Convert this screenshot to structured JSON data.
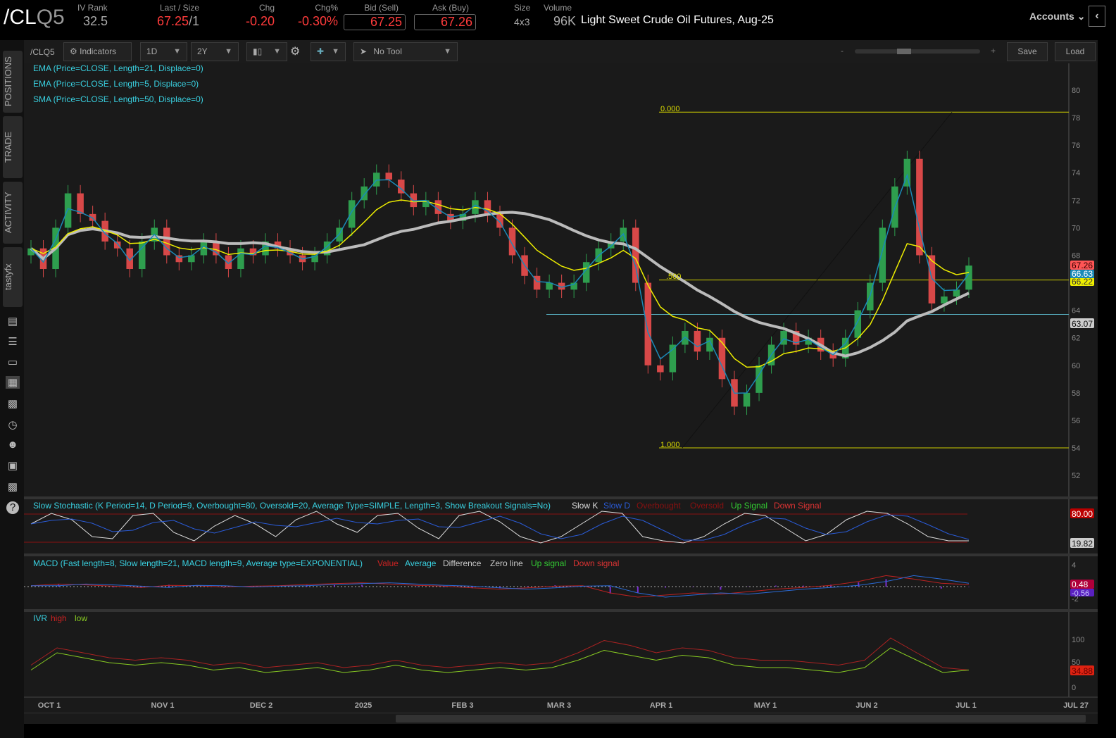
{
  "header": {
    "symbol_main": "/CL",
    "symbol_sub": "Q5",
    "iv_rank_label": "IV Rank",
    "iv_rank": "32.5",
    "last_label": "Last / Size",
    "last": "67.25",
    "size": "/1",
    "chg_label": "Chg",
    "chg": "-0.20",
    "chgp_label": "Chg%",
    "chgp": "-0.30%",
    "bid_label": "Bid (Sell)",
    "bid": "67.25",
    "ask_label": "Ask (Buy)",
    "ask": "67.26",
    "sz_label": "Size",
    "sz": "4x3",
    "vol_label": "Volume",
    "vol": "96K",
    "title": "Light Sweet Crude Oil Futures, Aug-25",
    "accounts": "Accounts"
  },
  "sidebar": {
    "tabs": [
      "POSITIONS",
      "TRADE",
      "ACTIVITY",
      "tastyfx"
    ]
  },
  "toolbar": {
    "symbol": "/CLQ5",
    "indicators": "Indicators",
    "interval": "1D",
    "range": "2Y",
    "tool": "No Tool",
    "zoom_minus": "-",
    "zoom_plus": "+",
    "save": "Save",
    "load": "Load"
  },
  "studies": [
    "EMA (Price=CLOSE, Length=21, Displace=0)",
    "EMA (Price=CLOSE, Length=5, Displace=0)",
    "SMA (Price=CLOSE, Length=50, Displace=0)"
  ],
  "fib": {
    "top": "0.000",
    "mid": ".500",
    "bottom": "1.000",
    "top_price": 78.4,
    "bottom_price": 54.0
  },
  "support_level": 63.7,
  "price_axis": [
    "80",
    "78",
    "76",
    "74",
    "72",
    "70",
    "68",
    "66",
    "64",
    "62",
    "60",
    "58",
    "56",
    "54",
    "52"
  ],
  "price_badges": {
    "last": "67.26",
    "ema5": "66.63",
    "ema21": "66.22",
    "sma50": "63.07"
  },
  "stoch": {
    "title": "Slow Stochastic (K Period=14, D Period=9, Overbought=80, Oversold=20, Average Type=SIMPLE, Length=3, Show Breakout Signals=No)",
    "legend": [
      "Slow K",
      "Slow D",
      "Overbought",
      "Oversold",
      "Up Signal",
      "Down Signal"
    ],
    "badge_ob": "80.00",
    "badge_k": "19.82"
  },
  "macd": {
    "title": "MACD (Fast length=8, Slow length=21, MACD length=9, Average type=EXPONENTIAL)",
    "legend": [
      "Value",
      "Average",
      "Difference",
      "Zero line",
      "Up signal",
      "Down signal"
    ],
    "axis": [
      "4",
      "-2"
    ],
    "badge_value": "0.48",
    "badge_avg": "-0.56"
  },
  "ivr": {
    "title": "IVR",
    "legend": [
      "high",
      "low"
    ],
    "axis": [
      "100",
      "50",
      "0"
    ],
    "badge": "34.88"
  },
  "x_axis": [
    "OCT 1",
    "NOV 1",
    "DEC 2",
    "2025",
    "FEB 3",
    "MAR 3",
    "APR 1",
    "MAY 1",
    "JUN 2",
    "JUL 1",
    "JUL 27"
  ],
  "chart_data": {
    "type": "candlestick",
    "series_name": "/CLQ5 daily close (approx)",
    "closes": [
      68.5,
      67,
      70,
      72.5,
      71,
      70.5,
      69,
      68.5,
      67,
      69,
      70,
      68,
      67.5,
      68,
      69,
      68,
      67,
      68.5,
      68,
      69,
      68.5,
      68,
      67.5,
      68,
      69,
      70,
      72,
      73,
      74,
      73.5,
      72.5,
      71.5,
      72,
      71,
      70.5,
      71,
      72,
      71,
      70,
      68,
      66.5,
      65.5,
      66,
      65.5,
      66,
      67.5,
      68.5,
      69,
      70,
      66,
      60,
      59.5,
      61.5,
      62.5,
      61,
      62,
      59,
      57,
      58,
      60,
      61.5,
      62.5,
      61.5,
      62,
      61,
      60.5,
      62,
      64,
      66,
      70,
      73,
      75,
      68,
      64.5,
      65,
      65.5,
      67.25
    ],
    "stoch_k": [
      60,
      85,
      70,
      30,
      25,
      80,
      85,
      40,
      20,
      55,
      80,
      60,
      30,
      70,
      90,
      60,
      40,
      80,
      85,
      50,
      25,
      80,
      90,
      65,
      30,
      15,
      30,
      60,
      90,
      85,
      30,
      20,
      15,
      30,
      60,
      85,
      80,
      50,
      20,
      35,
      70,
      90,
      85,
      60,
      30,
      20,
      20
    ],
    "macd_value": [
      0.2,
      0.6,
      0.4,
      0.1,
      -0.2,
      0.3,
      0.2,
      -0.1,
      0.1,
      0.2,
      0.5,
      0.7,
      0.9,
      0.6,
      0.3,
      0.1,
      -0.3,
      -0.6,
      -0.3,
      0.1,
      0.2,
      -1.5,
      -2.5,
      -2.0,
      -1.5,
      -1.8,
      -1.2,
      -0.6,
      -0.2,
      0.3,
      1.2,
      2.6,
      1.8,
      0.8,
      0.48
    ],
    "ivr_high": [
      45,
      80,
      70,
      60,
      55,
      60,
      55,
      45,
      50,
      40,
      45,
      50,
      40,
      45,
      55,
      45,
      40,
      45,
      50,
      45,
      50,
      70,
      95,
      85,
      70,
      80,
      75,
      60,
      55,
      55,
      50,
      45,
      55,
      100,
      70,
      40,
      35
    ],
    "ivr_low": [
      35,
      70,
      60,
      50,
      45,
      50,
      45,
      35,
      40,
      30,
      35,
      40,
      30,
      35,
      45,
      35,
      30,
      35,
      40,
      35,
      40,
      55,
      75,
      65,
      55,
      65,
      60,
      45,
      40,
      40,
      35,
      30,
      40,
      80,
      55,
      30,
      35
    ]
  }
}
